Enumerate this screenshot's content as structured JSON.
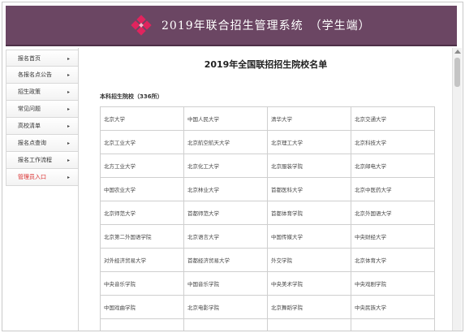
{
  "header": {
    "title": "2019年联合招生管理系统　（学生端）",
    "bg_color": "#6b4663",
    "logo_color": "#e0245e"
  },
  "sidebar": {
    "items": [
      {
        "label": "报名首页",
        "arrow": "▸"
      },
      {
        "label": "各报名点公告",
        "arrow": "▸"
      },
      {
        "label": "招生政策",
        "arrow": "▸"
      },
      {
        "label": "常见问题",
        "arrow": "▸"
      },
      {
        "label": "高校清单",
        "arrow": "▸"
      },
      {
        "label": "报名点查询",
        "arrow": "▸"
      },
      {
        "label": "报名工作流程",
        "arrow": "▸"
      },
      {
        "label": "管理员入口",
        "arrow": "▸",
        "highlight_color": "#d92b2b"
      }
    ]
  },
  "main": {
    "heading": "2019年全国联招招生院校名单",
    "section_label": "本科招生院校（336所）",
    "table": [
      [
        "北京大学",
        "中国人民大学",
        "清华大学",
        "北京交通大学"
      ],
      [
        "北京工业大学",
        "北京航空航天大学",
        "北京理工大学",
        "北京科技大学"
      ],
      [
        "北方工业大学",
        "北京化工大学",
        "北京服装学院",
        "北京邮电大学"
      ],
      [
        "中国农业大学",
        "北京林业大学",
        "首都医科大学",
        "北京中医药大学"
      ],
      [
        "北京师范大学",
        "首都师范大学",
        "首都体育学院",
        "北京外国语大学"
      ],
      [
        "北京第二外国语学院",
        "北京语言大学",
        "中国传媒大学",
        "中央财经大学"
      ],
      [
        "对外经济贸易大学",
        "首都经济贸易大学",
        "外交学院",
        "北京体育大学"
      ],
      [
        "中央音乐学院",
        "中国音乐学院",
        "中央美术学院",
        "中央戏剧学院"
      ],
      [
        "中国戏曲学院",
        "北京电影学院",
        "北京舞蹈学院",
        "中央民族大学"
      ],
      [
        "",
        "",
        "",
        ""
      ]
    ]
  }
}
